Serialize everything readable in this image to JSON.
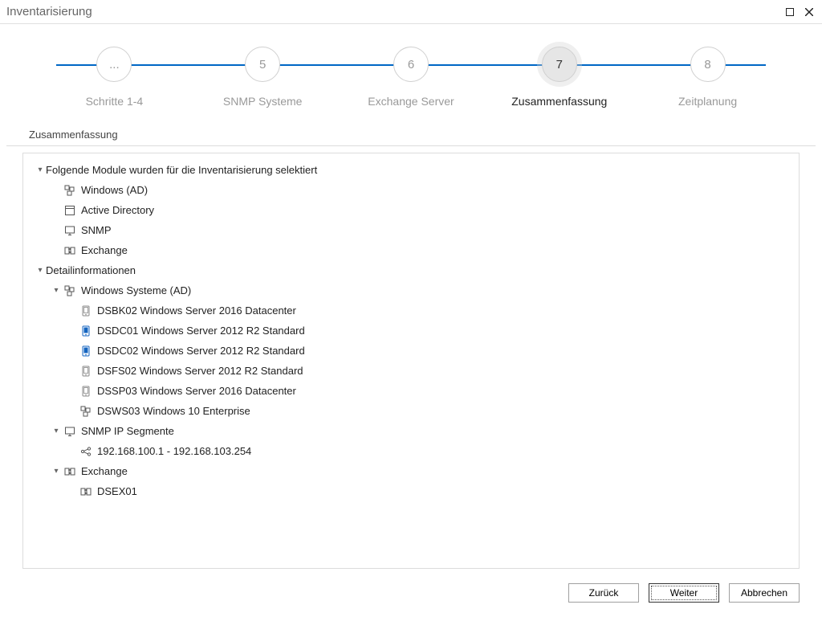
{
  "window": {
    "title": "Inventarisierung"
  },
  "steps": [
    {
      "num": "...",
      "label": "Schritte 1-4"
    },
    {
      "num": "5",
      "label": "SNMP Systeme"
    },
    {
      "num": "6",
      "label": "Exchange Server"
    },
    {
      "num": "7",
      "label": "Zusammenfassung"
    },
    {
      "num": "8",
      "label": "Zeitplanung"
    }
  ],
  "active_step_index": 3,
  "section_title": "Zusammenfassung",
  "tree": {
    "modules_header": "Folgende Module wurden für die Inventarisierung selektiert",
    "modules": [
      {
        "label": "Windows (AD)",
        "icon": "windows-ad"
      },
      {
        "label": "Active Directory",
        "icon": "ad"
      },
      {
        "label": "SNMP",
        "icon": "monitor"
      },
      {
        "label": "Exchange",
        "icon": "exchange"
      }
    ],
    "details_header": "Detailinformationen",
    "windows_group": "Windows Systeme (AD)",
    "windows_items": [
      {
        "label": "DSBK02 Windows Server 2016 Datacenter",
        "icon": "device-gray"
      },
      {
        "label": "DSDC01 Windows Server 2012 R2 Standard",
        "icon": "device-blue"
      },
      {
        "label": "DSDC02 Windows Server 2012 R2 Standard",
        "icon": "device-blue"
      },
      {
        "label": "DSFS02 Windows Server 2012 R2 Standard",
        "icon": "device-gray"
      },
      {
        "label": "DSSP03 Windows Server 2016 Datacenter",
        "icon": "device-gray"
      },
      {
        "label": "DSWS03 Windows 10 Enterprise",
        "icon": "windows-ad"
      }
    ],
    "snmp_group": "SNMP IP Segmente",
    "snmp_items": [
      {
        "label": "192.168.100.1 - 192.168.103.254",
        "icon": "share"
      }
    ],
    "exchange_group": "Exchange",
    "exchange_items": [
      {
        "label": "DSEX01",
        "icon": "exchange"
      }
    ]
  },
  "buttons": {
    "back": "Zurück",
    "next": "Weiter",
    "cancel": "Abbrechen"
  }
}
